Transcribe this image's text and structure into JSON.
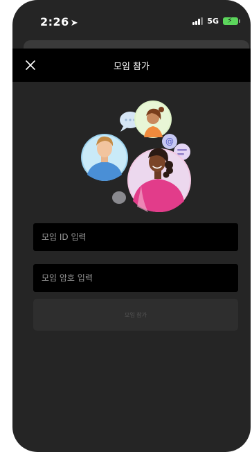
{
  "status_bar": {
    "time": "2:26",
    "network": "5G",
    "location_icon": "location-arrow-icon",
    "signal_icon": "signal-bars-icon",
    "battery_icon": "battery-charging-icon"
  },
  "nav": {
    "title": "모임 참가",
    "close_icon": "close-icon"
  },
  "illustration": {
    "name": "people-chat-illustration"
  },
  "form": {
    "meeting_id_placeholder": "모임 ID 입력",
    "meeting_id_value": "",
    "password_placeholder": "모임 암호 입력",
    "password_value": ""
  },
  "join_button": {
    "label": "모임 참가",
    "enabled": false
  },
  "colors": {
    "background": "#252525",
    "nav_background": "#000000",
    "input_background": "#000000",
    "button_disabled": "#2e2e2e",
    "battery": "#5cd65c"
  }
}
